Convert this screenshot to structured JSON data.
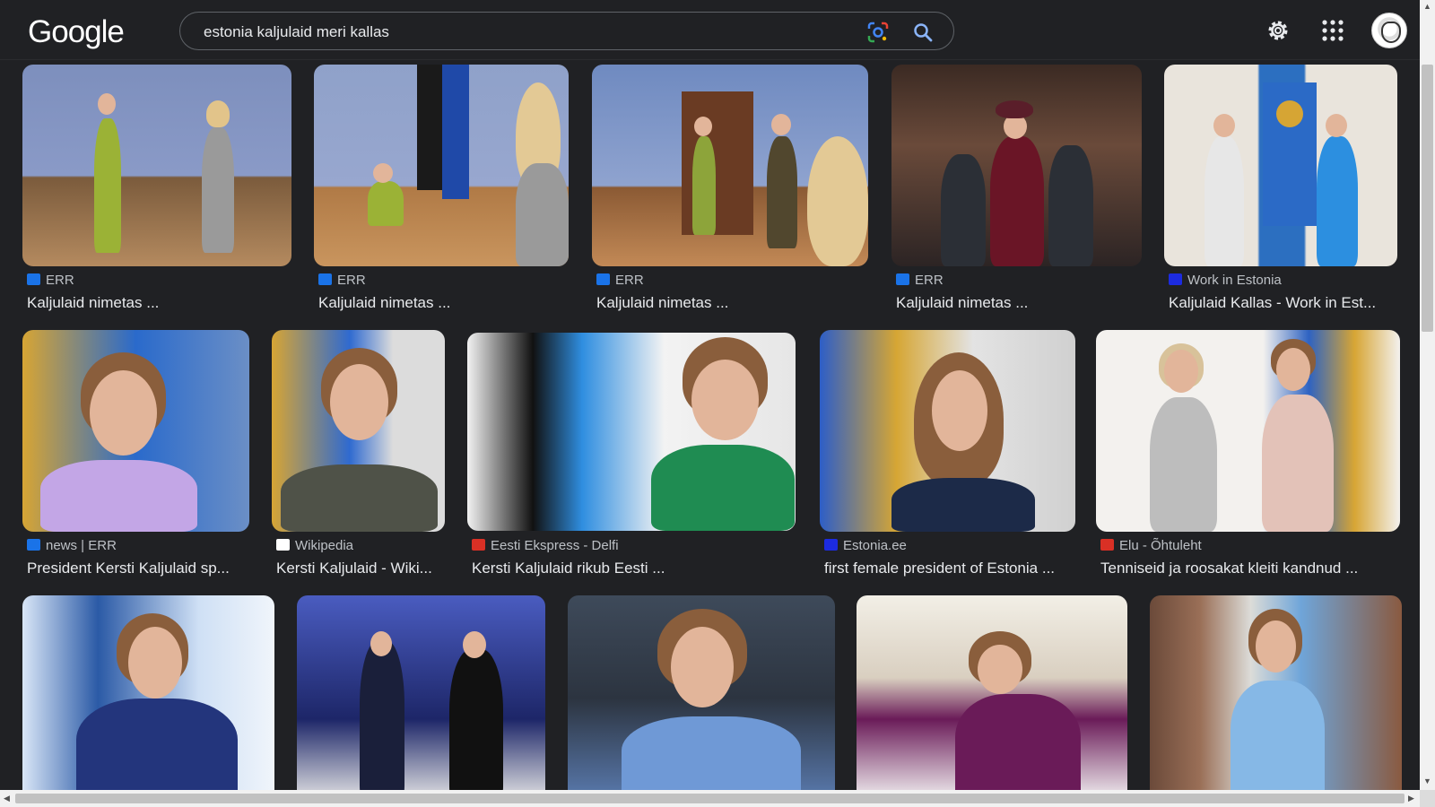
{
  "header": {
    "logo_text": "Google",
    "search_value": "estonia kaljulaid meri kallas"
  },
  "results": [
    {
      "source": "ERR",
      "caption": "Kaljulaid nimetas ...",
      "fav_color": "#1a73e8"
    },
    {
      "source": "ERR",
      "caption": "Kaljulaid nimetas ...",
      "fav_color": "#1a73e8"
    },
    {
      "source": "ERR",
      "caption": "Kaljulaid nimetas ...",
      "fav_color": "#1a73e8"
    },
    {
      "source": "ERR",
      "caption": "Kaljulaid nimetas ...",
      "fav_color": "#1a73e8"
    },
    {
      "source": "Work in Estonia",
      "caption": "Kaljulaid Kallas - Work in Est...",
      "fav_color": "#1c2be0"
    },
    {
      "source": "news | ERR",
      "caption": "President Kersti Kaljulaid sp...",
      "fav_color": "#1a73e8"
    },
    {
      "source": "Wikipedia",
      "caption": "Kersti Kaljulaid - Wiki...",
      "fav_color": "#ffffff"
    },
    {
      "source": "Eesti Ekspress - Delfi",
      "caption": "Kersti Kaljulaid rikub Eesti ...",
      "fav_color": "#d93025"
    },
    {
      "source": "Estonia.ee",
      "caption": "first female president of Estonia ...",
      "fav_color": "#1c2be0"
    },
    {
      "source": "Elu - Õhtuleht",
      "caption": "Tenniseid ja roosakat kleiti kandnud ...",
      "fav_color": "#d93025"
    }
  ]
}
